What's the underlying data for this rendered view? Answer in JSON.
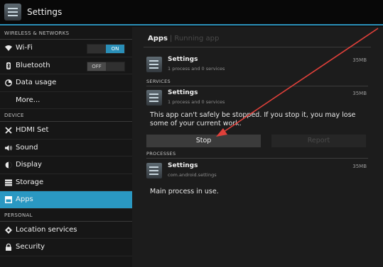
{
  "titlebar": {
    "title": "Settings"
  },
  "sidebar": {
    "headers": {
      "wireless": "WIRELESS & NETWORKS",
      "device": "DEVICE",
      "personal": "PERSONAL"
    },
    "wifi": {
      "label": "Wi-Fi",
      "toggle": "ON",
      "icon": "wifi-icon"
    },
    "bluetooth": {
      "label": "Bluetooth",
      "toggle": "OFF",
      "icon": "bluetooth-icon"
    },
    "data_usage": {
      "label": "Data usage",
      "icon": "data-usage-icon"
    },
    "more": {
      "label": "More..."
    },
    "hdmi": {
      "label": "HDMI Set",
      "icon": "tools-icon"
    },
    "sound": {
      "label": "Sound",
      "icon": "speaker-icon"
    },
    "display": {
      "label": "Display",
      "icon": "display-icon"
    },
    "storage": {
      "label": "Storage",
      "icon": "storage-icon"
    },
    "apps": {
      "label": "Apps",
      "icon": "apps-icon"
    },
    "location": {
      "label": "Location services",
      "icon": "location-icon"
    },
    "security": {
      "label": "Security",
      "icon": "lock-icon"
    }
  },
  "main": {
    "tabs": {
      "active": "Apps",
      "inactive": "Running app"
    },
    "app_row": {
      "title": "Settings",
      "subtitle": "1 process and 0 services",
      "size": "35MB"
    },
    "services_header": "SERVICES",
    "service_row": {
      "title": "Settings",
      "subtitle": "1 process and 0 services",
      "size": "35MB"
    },
    "warning": "This app can't safely be stopped. If you stop it, you may lose some of your current work.",
    "stop_button": "Stop",
    "report_button": "Report",
    "processes_header": "PROCESSES",
    "process_row": {
      "title": "Settings",
      "subtitle": "com.android.settings",
      "size": "35MB"
    },
    "main_process": "Main process in use."
  },
  "colors": {
    "accent": "#2a98c2",
    "annotation_arrow": "#e0403a"
  }
}
